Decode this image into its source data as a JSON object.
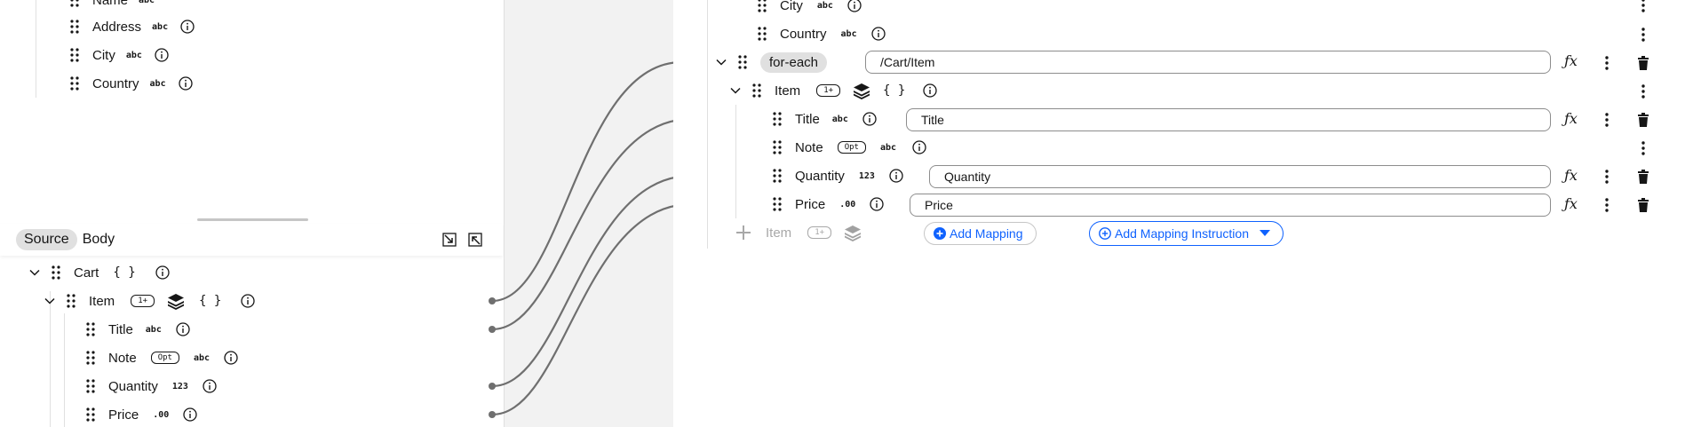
{
  "left_top": {
    "items": [
      {
        "label": "Name",
        "type": "abc"
      },
      {
        "label": "Address",
        "type": "abc"
      },
      {
        "label": "City",
        "type": "abc"
      },
      {
        "label": "Country",
        "type": "abc"
      }
    ]
  },
  "source": {
    "tab_source": "Source",
    "tab_body": "Body",
    "cart": {
      "label": "Cart",
      "type": "{ }"
    },
    "item": {
      "label": "Item",
      "badge": "1+",
      "type": "{ }"
    },
    "children": [
      {
        "label": "Title",
        "type": "abc"
      },
      {
        "label": "Note",
        "badge": "Opt",
        "type": "abc"
      },
      {
        "label": "Quantity",
        "type": "123"
      },
      {
        "label": "Price",
        "type": ".00"
      }
    ]
  },
  "target": {
    "top_items": [
      {
        "label": "City",
        "type": "abc"
      },
      {
        "label": "Country",
        "type": "abc"
      }
    ],
    "foreach": {
      "label": "for-each",
      "xpath": "/Cart/Item"
    },
    "item": {
      "label": "Item",
      "badge": "1+",
      "type": "{ }"
    },
    "children": [
      {
        "label": "Title",
        "type": "abc",
        "mapping": "Title"
      },
      {
        "label": "Note",
        "badge": "Opt",
        "type": "abc",
        "mapping": ""
      },
      {
        "label": "Quantity",
        "type": "123",
        "mapping": "Quantity"
      },
      {
        "label": "Price",
        "type": ".00",
        "mapping": "Price"
      }
    ],
    "add_item": {
      "label": "Item",
      "badge": "1+"
    },
    "add_mapping_label": "Add Mapping",
    "add_instruction_label": "Add Mapping Instruction",
    "fx_symbol": "ƒx"
  },
  "colors": {
    "accent": "#0f62fe",
    "connector": "#6f6f6f",
    "gutter": "#f2f2f2"
  }
}
